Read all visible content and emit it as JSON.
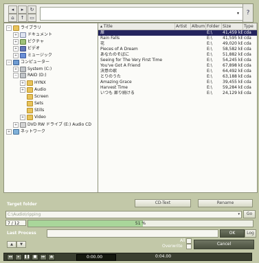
{
  "toolbar": {
    "path_value": "",
    "help_label": "?"
  },
  "tree": [
    {
      "label": "ライブラリ",
      "icon": "folder",
      "expander": "-",
      "level": 0
    },
    {
      "label": "ドキュメント",
      "icon": "doc",
      "expander": "+",
      "level": 1
    },
    {
      "label": "ピクチャ",
      "icon": "pic",
      "expander": "+",
      "level": 1
    },
    {
      "label": "ビデオ",
      "icon": "vid",
      "expander": "+",
      "level": 1
    },
    {
      "label": "ミュージック",
      "icon": "music",
      "expander": "+",
      "level": 1
    },
    {
      "label": "コンピューター",
      "icon": "pc",
      "expander": "-",
      "level": 0
    },
    {
      "label": "System (C:)",
      "icon": "drive",
      "expander": "+",
      "level": 1
    },
    {
      "label": "RAID (D:)",
      "icon": "drive",
      "expander": "-",
      "level": 1
    },
    {
      "label": "HYNX",
      "icon": "folder",
      "expander": "+",
      "level": 2
    },
    {
      "label": "Audio",
      "icon": "folder",
      "expander": "+",
      "level": 2
    },
    {
      "label": "Screen",
      "icon": "folder",
      "expander": "",
      "level": 2
    },
    {
      "label": "Sets",
      "icon": "folder",
      "expander": "",
      "level": 2
    },
    {
      "label": "Stills",
      "icon": "folder",
      "expander": "",
      "level": 2
    },
    {
      "label": "Video",
      "icon": "folder",
      "expander": "+",
      "level": 2
    },
    {
      "label": "DVD RW ドライブ (E:) Audio CD",
      "icon": "dvd",
      "expander": "+",
      "level": 1
    },
    {
      "label": "ネットワーク",
      "icon": "net",
      "expander": "+",
      "level": 0
    }
  ],
  "table": {
    "columns": [
      "Title",
      "Artist",
      "Album",
      "Folder",
      "Size",
      "Type"
    ],
    "rows": [
      {
        "title": "扉",
        "artist": "",
        "album": "",
        "folder": "E:\\",
        "size": "41,459 kB",
        "type": "cda",
        "selected": true
      },
      {
        "title": "Rain Falls",
        "artist": "",
        "album": "",
        "folder": "E:\\",
        "size": "41,595 kB",
        "type": "cda"
      },
      {
        "title": "花",
        "artist": "",
        "album": "",
        "folder": "E:\\",
        "size": "49,020 kB",
        "type": "cda"
      },
      {
        "title": "Pieces of A Dream",
        "artist": "",
        "album": "",
        "folder": "E:\\",
        "size": "58,582 kB",
        "type": "cda"
      },
      {
        "title": "あなたのそばに",
        "artist": "",
        "album": "",
        "folder": "E:\\",
        "size": "51,882 kB",
        "type": "cda"
      },
      {
        "title": "Seeing for The Very First Time",
        "artist": "",
        "album": "",
        "folder": "E:\\",
        "size": "54,245 kB",
        "type": "cda"
      },
      {
        "title": "You've Got A Friend",
        "artist": "",
        "album": "",
        "folder": "E:\\",
        "size": "67,898 kB",
        "type": "cda"
      },
      {
        "title": "決意の歌",
        "artist": "",
        "album": "",
        "folder": "E:\\",
        "size": "64,492 kB",
        "type": "cda"
      },
      {
        "title": "とりのうた",
        "artist": "",
        "album": "",
        "folder": "E:\\",
        "size": "63,188 kB",
        "type": "cda"
      },
      {
        "title": "Amazing Grace",
        "artist": "",
        "album": "",
        "folder": "E:\\",
        "size": "39,455 kB",
        "type": "cda"
      },
      {
        "title": "Harvest Time",
        "artist": "",
        "album": "",
        "folder": "E:\\",
        "size": "59,284 kB",
        "type": "cda"
      },
      {
        "title": "いつも 扉り続ける",
        "artist": "",
        "album": "",
        "folder": "E:\\",
        "size": "24,129 kB",
        "type": "cda"
      }
    ]
  },
  "lower": {
    "target_label": "Target folder",
    "cd_text_btn": "CD-Text",
    "rename_btn": "Rename",
    "target_value": "C:\\Audio\\ripping",
    "go_btn": "Go",
    "progress_count": "7 / 12",
    "progress_pct": "51 %",
    "progress_fraction": 0.51,
    "last_label": "Last Process",
    "ok_btn": "OK",
    "log_btn": "Log",
    "all_label": "All",
    "overwrite_label": "Overwrite",
    "cancel_btn": "Cancel",
    "time_current": "0:00.00",
    "time_total": "0:04.00"
  },
  "colors": {
    "accent": "#24245e",
    "progress": "#a9d69a",
    "panel": "#c2c8a8"
  }
}
